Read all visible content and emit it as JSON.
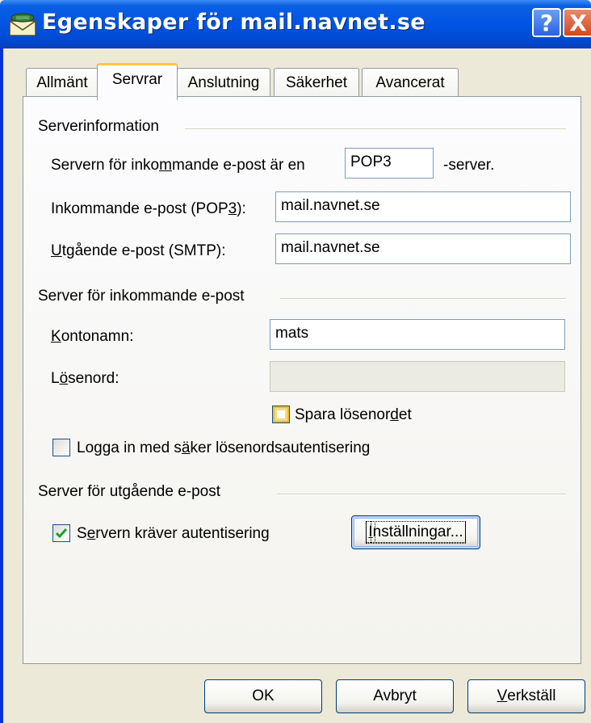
{
  "window": {
    "title": "Egenskaper för mail.navnet.se",
    "help_button": "?",
    "close_button": "X"
  },
  "tabs": [
    {
      "label": "Allmänt",
      "active": false
    },
    {
      "label": "Servrar",
      "active": true
    },
    {
      "label": "Anslutning",
      "active": false
    },
    {
      "label": "Säkerhet",
      "active": false
    },
    {
      "label": "Avancerat",
      "active": false
    }
  ],
  "server_info": {
    "group_title": "Serverinformation",
    "incoming_type_label_pre": "Servern för inko",
    "incoming_type_label_ul": "m",
    "incoming_type_label_post": "mande e-post är en",
    "incoming_type_value": "POP3",
    "incoming_type_suffix": "-server.",
    "incoming_label_pre": "Inkommande e-post (POP",
    "incoming_label_ul": "3",
    "incoming_label_post": "):",
    "incoming_value": "mail.navnet.se",
    "outgoing_label_ul": "U",
    "outgoing_label_post": "tgående e-post (SMTP):",
    "outgoing_value": "mail.navnet.se"
  },
  "incoming_server": {
    "group_title": "Server för inkommande e-post",
    "account_label_ul": "K",
    "account_label_post": "ontonamn:",
    "account_value": "mats",
    "password_label_pre": "L",
    "password_label_ul": "ö",
    "password_label_post": "senord:",
    "password_value": "",
    "save_password_pre": "Spara lösenor",
    "save_password_ul": "d",
    "save_password_post": "et",
    "save_password_checked": false,
    "spa_pre": "Logga in med s",
    "spa_ul": "ä",
    "spa_post": "ker lösenordsautentisering",
    "spa_checked": false
  },
  "outgoing_server": {
    "group_title": "Server för utgående e-post",
    "auth_pre": "S",
    "auth_ul": "e",
    "auth_post": "rvern kräver autentisering",
    "auth_checked": true,
    "settings_button_ul": "I",
    "settings_button_post": "nställningar..."
  },
  "footer": {
    "ok_label": "OK",
    "cancel_label": "Avbryt",
    "apply_label_ul": "V",
    "apply_label_post": "erkställ"
  },
  "colors": {
    "titlebar": "#0054e3",
    "dialog_bg": "#ece9d8",
    "active_tab_accent": "#ffc83c",
    "check_mark": "#21a121"
  }
}
